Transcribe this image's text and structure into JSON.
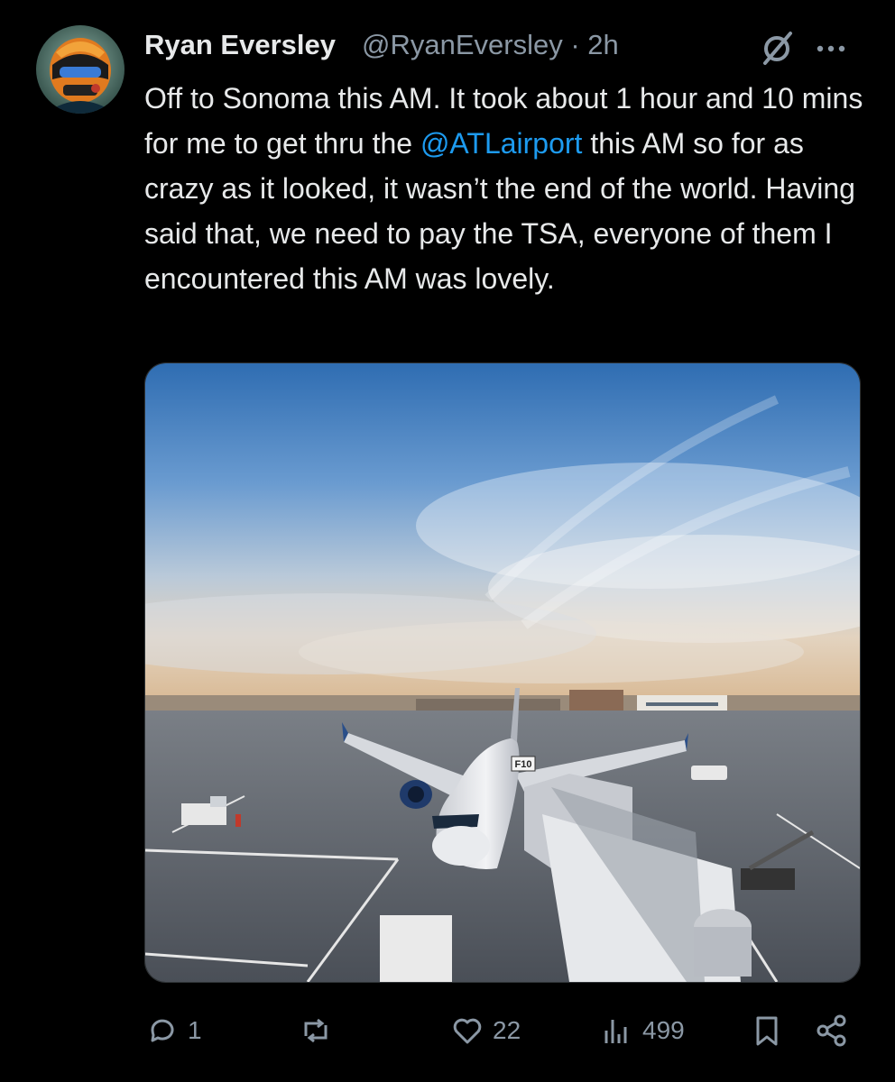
{
  "author": {
    "name": "Ryan Eversley",
    "handle": "@RyanEversley",
    "separator": "·",
    "time": "2h"
  },
  "tweet": {
    "text_before": "Off to Sonoma this AM. It took about 1 hour and 10 mins for me to get thru the ",
    "mention": "@ATLairport",
    "text_after": " this AM so for as crazy as it looked, it wasn’t the end of the world. Having said that, we need to pay the TSA, everyone of them I encountered this AM was lovely."
  },
  "media": {
    "gate_sign": "F10"
  },
  "actions": {
    "replies": "1",
    "reposts": "",
    "likes": "22",
    "views": "499"
  },
  "icons": {
    "grok": "grok-icon",
    "more": "more-icon",
    "reply": "reply-icon",
    "repost": "repost-icon",
    "like": "heart-icon",
    "views": "views-icon",
    "bookmark": "bookmark-icon",
    "share": "share-icon"
  },
  "colors": {
    "background": "#000000",
    "text": "#e7e9ea",
    "secondary": "#8b98a5",
    "accent": "#1d9bf0"
  }
}
